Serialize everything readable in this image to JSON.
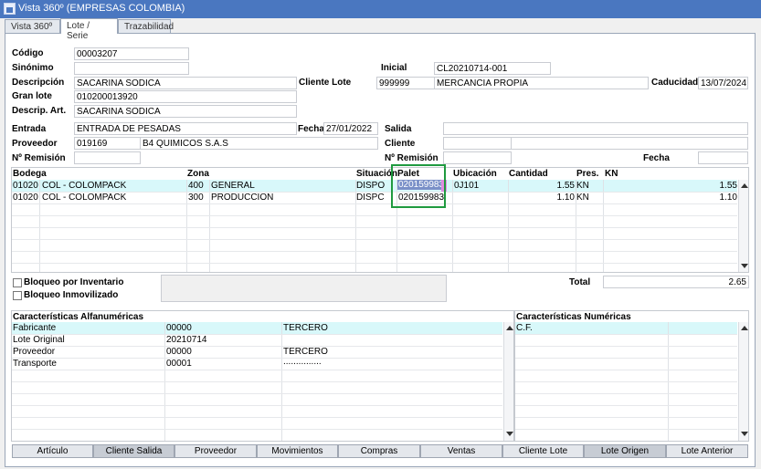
{
  "window": {
    "title": "Vista 360º (EMPRESAS COLOMBIA)"
  },
  "tabs": [
    "Vista 360º",
    "Lote / Serie",
    "Trazabilidad"
  ],
  "product": {
    "codigo_label": "Código",
    "codigo": "00003207",
    "sinonimo_label": "Sinónimo",
    "sinonimo": "",
    "descripcion_label": "Descripción",
    "descripcion": "SACARINA SODICA",
    "gran_lote_label": "Gran lote",
    "gran_lote": "010200013920",
    "descrip_art_label": "Descrip. Art.",
    "descrip_art": "SACARINA SODICA",
    "inicial_label": "Inicial",
    "inicial": "CL20210714-001",
    "cliente_lote_label": "Cliente Lote",
    "cliente_lote_code": "999999",
    "cliente_lote_name": "MERCANCIA PROPIA",
    "caducidad_label": "Caducidad",
    "caducidad": "13/07/2024"
  },
  "entrada": {
    "entrada_label": "Entrada",
    "entrada": "ENTRADA DE PESADAS",
    "fecha_label": "Fecha",
    "fecha": "27/01/2022",
    "proveedor_label": "Proveedor",
    "proveedor_code": "019169",
    "proveedor_name": "B4 QUIMICOS S.A.S",
    "remision_label": "Nº Remisión",
    "remision": ""
  },
  "salida": {
    "salida_label": "Salida",
    "salida": "",
    "cliente_label": "Cliente",
    "cliente_code": "",
    "cliente_name": "",
    "remision_label": "Nº Remisión",
    "remision": "",
    "fecha_label": "Fecha",
    "fecha": ""
  },
  "stock_grid": {
    "headers": {
      "bodega": "Bodega",
      "zona": "Zona",
      "situacion": "Situación",
      "palet": "Palet",
      "ubicacion": "Ubicación",
      "cantidad": "Cantidad",
      "pres": "Pres.",
      "kn": "KN"
    },
    "rows": [
      {
        "bodega": "01020",
        "bodega_name": "COL - COLOMPACK",
        "zona": "400",
        "zona_name": "GENERAL",
        "situacion": "DISPO",
        "palet": "020159983",
        "ubicacion": "0J101",
        "cantidad": "1.55",
        "pres": "KN",
        "kn": "1.55"
      },
      {
        "bodega": "01020",
        "bodega_name": "COL - COLOMPACK",
        "zona": "300",
        "zona_name": "PRODUCCION",
        "situacion": "DISPC",
        "palet": "020159983",
        "ubicacion": "",
        "cantidad": "1.10",
        "pres": "KN",
        "kn": "1.10"
      }
    ]
  },
  "checks": {
    "bloqueo_inventario": "Bloqueo por Inventario",
    "bloqueo_inmovilizado": "Bloqueo Inmovilizado"
  },
  "total": {
    "label": "Total",
    "value": "2.65"
  },
  "alfa_grid": {
    "title": "Características Alfanuméricas",
    "rows": [
      {
        "name": "Fabricante",
        "code": "00000",
        "value": "TERCERO"
      },
      {
        "name": "Lote Original",
        "code": "20210714",
        "value": ""
      },
      {
        "name": "Proveedor",
        "code": "00000",
        "value": "TERCERO"
      },
      {
        "name": "Transporte",
        "code": "00001",
        "value": "..............."
      }
    ]
  },
  "num_grid": {
    "title": "Características Numéricas",
    "rows": [
      {
        "name": "C.F.",
        "value": ""
      }
    ]
  },
  "buttons": [
    "Artículo",
    "Cliente Salida",
    "Proveedor",
    "Movimientos",
    "Compras",
    "Ventas",
    "Cliente Lote",
    "Lote Origen",
    "Lote Anterior"
  ],
  "colors": {
    "titlebar": "#4a77c0",
    "row_highlight": "#d8f8fa",
    "palet_highlight": "#1f9a3f"
  }
}
